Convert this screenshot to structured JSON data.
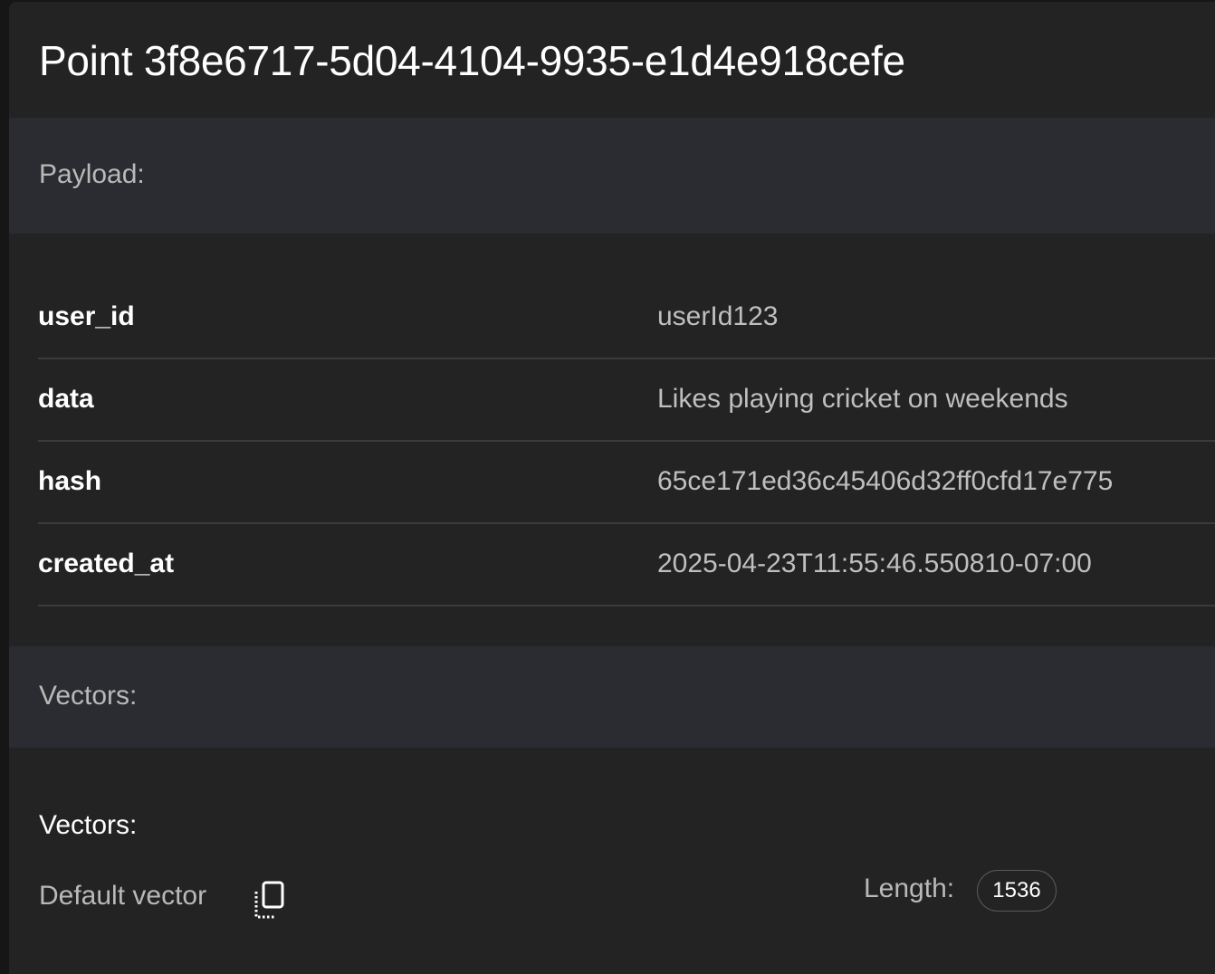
{
  "point": {
    "title": "Point 3f8e6717-5d04-4104-9935-e1d4e918cefe"
  },
  "payload": {
    "header": "Payload:",
    "rows": [
      {
        "key": "user_id",
        "value": "userId123"
      },
      {
        "key": "data",
        "value": "Likes playing cricket on weekends"
      },
      {
        "key": "hash",
        "value": "65ce171ed36c45406d32ff0cfd17e775"
      },
      {
        "key": "created_at",
        "value": "2025-04-23T11:55:46.550810-07:00"
      }
    ]
  },
  "vectors": {
    "header": "Vectors:",
    "title": "Vectors:",
    "default_vector_label": "Default vector",
    "copy_icon": "copy-icon",
    "length_label": "Length:",
    "length_value": "1536"
  },
  "colors": {
    "background": "#161616",
    "card": "#232323",
    "section_header": "#2b2c31",
    "divider": "#3b3b3b",
    "text_primary": "#ffffff",
    "text_secondary": "#bfbfbf"
  }
}
